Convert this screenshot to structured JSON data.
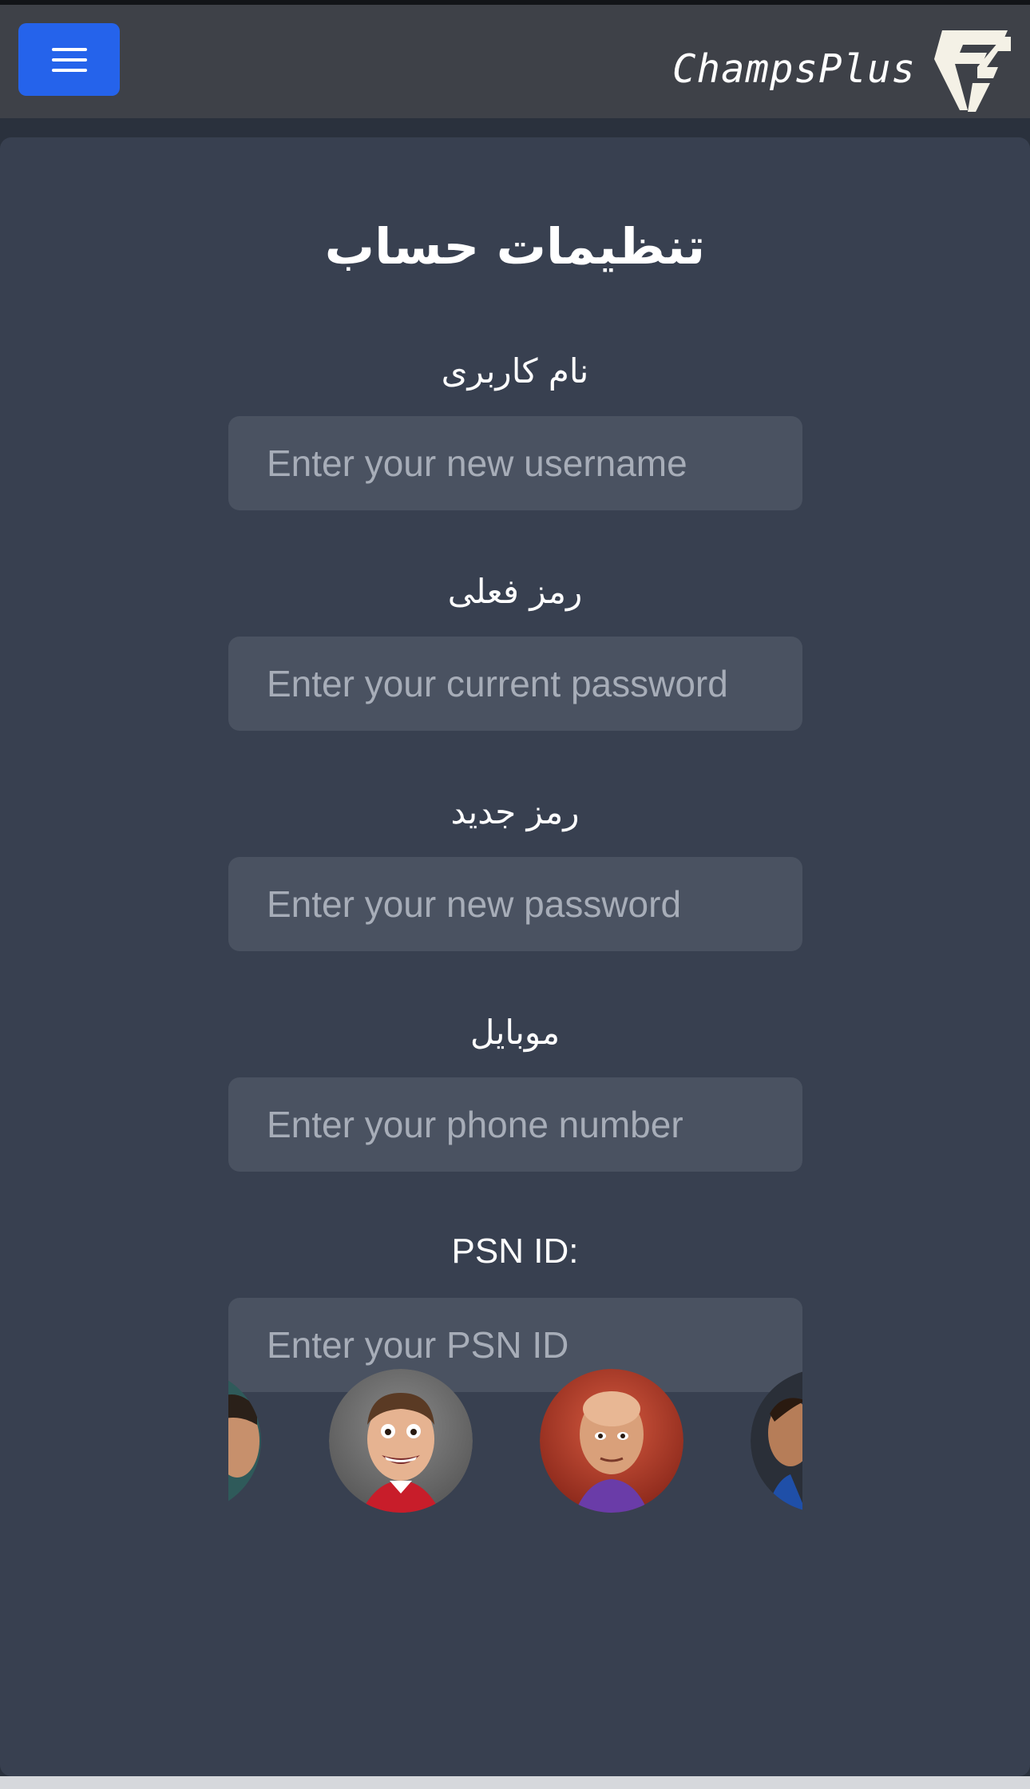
{
  "header": {
    "menu_icon": "hamburger-menu-icon",
    "brand_name": "ChampsPlus",
    "logo_icon": "fc-logo-icon",
    "brand_color": "#2563eb"
  },
  "settings": {
    "title": "تنظیمات حساب",
    "fields": [
      {
        "label": "نام کاربری",
        "placeholder": "Enter your new username",
        "value": ""
      },
      {
        "label": "رمز فعلی",
        "placeholder": "Enter your current password",
        "value": ""
      },
      {
        "label": "رمز جدید",
        "placeholder": "Enter your new password",
        "value": ""
      },
      {
        "label": "موبایل",
        "placeholder": "Enter your phone number",
        "value": ""
      },
      {
        "label": "PSN ID:",
        "placeholder": "Enter your PSN ID",
        "value": ""
      }
    ]
  },
  "avatars": [
    {
      "icon": "player-avatar-partial-left"
    },
    {
      "icon": "player-avatar-red-jersey"
    },
    {
      "icon": "player-avatar-bald-purple"
    },
    {
      "icon": "player-avatar-partial-right"
    }
  ]
}
